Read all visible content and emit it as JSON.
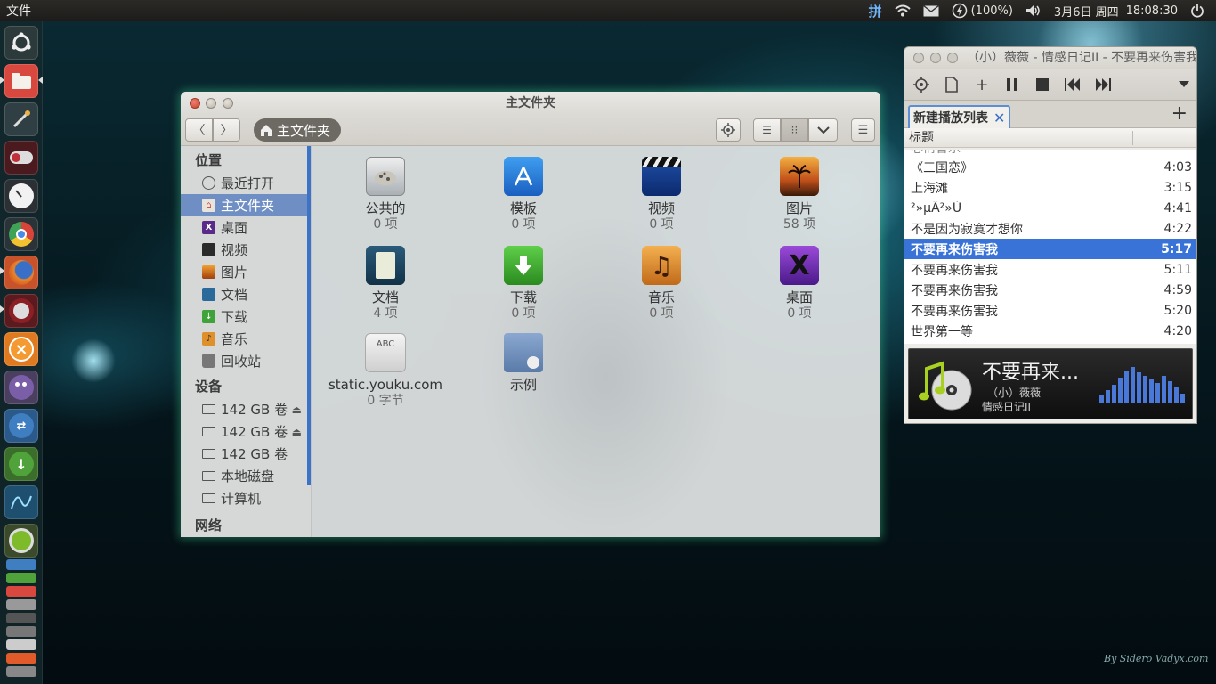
{
  "top_panel": {
    "app_menu": "文件",
    "input_method": "拼",
    "battery": "(100%)",
    "date": "3月6日 周四",
    "time": "18:08:30"
  },
  "launcher": {
    "items": [
      "ubuntu-icon",
      "files-icon",
      "settings-icon",
      "toggle-icon",
      "clock-icon",
      "chrome-icon",
      "firefox-icon",
      "media-icon",
      "close-app-icon",
      "pidgin-icon",
      "transfer-icon",
      "download-icon",
      "monitor-icon",
      "ubuntu-one-icon"
    ]
  },
  "file_manager": {
    "title": "主文件夹",
    "breadcrumb": "主文件夹",
    "sidebar": {
      "places_heading": "位置",
      "places": [
        {
          "label": "最近打开",
          "icon": "clock-icon"
        },
        {
          "label": "主文件夹",
          "icon": "home-icon"
        },
        {
          "label": "桌面",
          "icon": "desktop-icon"
        },
        {
          "label": "视频",
          "icon": "video-icon"
        },
        {
          "label": "图片",
          "icon": "pictures-icon"
        },
        {
          "label": "文档",
          "icon": "documents-icon"
        },
        {
          "label": "下载",
          "icon": "download-icon"
        },
        {
          "label": "音乐",
          "icon": "music-icon"
        },
        {
          "label": "回收站",
          "icon": "trash-icon"
        }
      ],
      "devices_heading": "设备",
      "devices": [
        {
          "label": "142 GB 卷",
          "eject": true
        },
        {
          "label": "142 GB 卷",
          "eject": true
        },
        {
          "label": "142 GB 卷",
          "eject": false
        },
        {
          "label": "本地磁盘",
          "eject": false
        },
        {
          "label": "计算机",
          "eject": false
        }
      ],
      "network_heading": "网络"
    },
    "items": [
      {
        "name": "公共的",
        "count": "0 项"
      },
      {
        "name": "模板",
        "count": "0 项"
      },
      {
        "name": "视频",
        "count": "0 项"
      },
      {
        "name": "图片",
        "count": "58 项"
      },
      {
        "name": "文档",
        "count": "4 项"
      },
      {
        "name": "下载",
        "count": "0 项"
      },
      {
        "name": "音乐",
        "count": "0 项"
      },
      {
        "name": "桌面",
        "count": "0 项"
      },
      {
        "name": "static.youku.com",
        "count": "0 字节"
      },
      {
        "name": "示例",
        "count": ""
      }
    ]
  },
  "music_player": {
    "title": "（小）薇薇 - 情感日记II - 不要再来伤害我",
    "playlist_tab": "新建播放列表",
    "column_title": "标题",
    "partial_row": "心情音乐",
    "tracks": [
      {
        "title": "《三国恋》",
        "duration": "4:03"
      },
      {
        "title": "上海滩",
        "duration": "3:15"
      },
      {
        "title": "²»µÃ²»Ù",
        "duration": "4:41"
      },
      {
        "title": "不是因为寂寞才想你",
        "duration": "4:22"
      },
      {
        "title": "不要再来伤害我",
        "duration": "5:17"
      },
      {
        "title": "不要再来伤害我",
        "duration": "5:11"
      },
      {
        "title": "不要再来伤害我",
        "duration": "4:59"
      },
      {
        "title": "不要再来伤害我",
        "duration": "5:20"
      },
      {
        "title": "世界第一等",
        "duration": "4:20"
      }
    ],
    "selected_index": 4,
    "now_playing": {
      "title": "不要再来...",
      "artist": "（小）薇薇",
      "album": "情感日记II"
    }
  },
  "signature": "By Sidero Vadyx.com"
}
